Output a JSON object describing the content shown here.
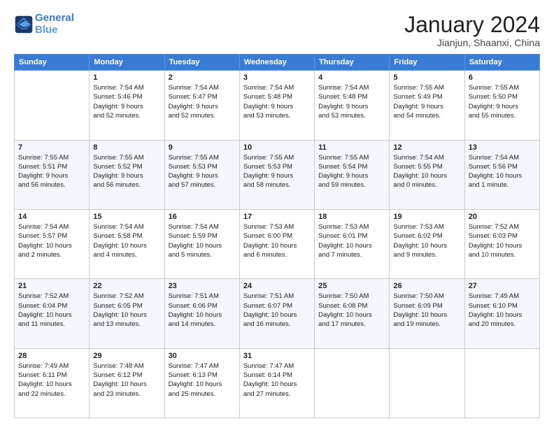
{
  "header": {
    "logo_line1": "General",
    "logo_line2": "Blue",
    "month_title": "January 2024",
    "subtitle": "Jianjun, Shaanxi, China"
  },
  "weekdays": [
    "Sunday",
    "Monday",
    "Tuesday",
    "Wednesday",
    "Thursday",
    "Friday",
    "Saturday"
  ],
  "weeks": [
    [
      {
        "day": "",
        "lines": []
      },
      {
        "day": "1",
        "lines": [
          "Sunrise: 7:54 AM",
          "Sunset: 5:46 PM",
          "Daylight: 9 hours",
          "and 52 minutes."
        ]
      },
      {
        "day": "2",
        "lines": [
          "Sunrise: 7:54 AM",
          "Sunset: 5:47 PM",
          "Daylight: 9 hours",
          "and 52 minutes."
        ]
      },
      {
        "day": "3",
        "lines": [
          "Sunrise: 7:54 AM",
          "Sunset: 5:48 PM",
          "Daylight: 9 hours",
          "and 53 minutes."
        ]
      },
      {
        "day": "4",
        "lines": [
          "Sunrise: 7:54 AM",
          "Sunset: 5:48 PM",
          "Daylight: 9 hours",
          "and 53 minutes."
        ]
      },
      {
        "day": "5",
        "lines": [
          "Sunrise: 7:55 AM",
          "Sunset: 5:49 PM",
          "Daylight: 9 hours",
          "and 54 minutes."
        ]
      },
      {
        "day": "6",
        "lines": [
          "Sunrise: 7:55 AM",
          "Sunset: 5:50 PM",
          "Daylight: 9 hours",
          "and 55 minutes."
        ]
      }
    ],
    [
      {
        "day": "7",
        "lines": [
          "Sunrise: 7:55 AM",
          "Sunset: 5:51 PM",
          "Daylight: 9 hours",
          "and 56 minutes."
        ]
      },
      {
        "day": "8",
        "lines": [
          "Sunrise: 7:55 AM",
          "Sunset: 5:52 PM",
          "Daylight: 9 hours",
          "and 56 minutes."
        ]
      },
      {
        "day": "9",
        "lines": [
          "Sunrise: 7:55 AM",
          "Sunset: 5:53 PM",
          "Daylight: 9 hours",
          "and 57 minutes."
        ]
      },
      {
        "day": "10",
        "lines": [
          "Sunrise: 7:55 AM",
          "Sunset: 5:53 PM",
          "Daylight: 9 hours",
          "and 58 minutes."
        ]
      },
      {
        "day": "11",
        "lines": [
          "Sunrise: 7:55 AM",
          "Sunset: 5:54 PM",
          "Daylight: 9 hours",
          "and 59 minutes."
        ]
      },
      {
        "day": "12",
        "lines": [
          "Sunrise: 7:54 AM",
          "Sunset: 5:55 PM",
          "Daylight: 10 hours",
          "and 0 minutes."
        ]
      },
      {
        "day": "13",
        "lines": [
          "Sunrise: 7:54 AM",
          "Sunset: 5:56 PM",
          "Daylight: 10 hours",
          "and 1 minute."
        ]
      }
    ],
    [
      {
        "day": "14",
        "lines": [
          "Sunrise: 7:54 AM",
          "Sunset: 5:57 PM",
          "Daylight: 10 hours",
          "and 2 minutes."
        ]
      },
      {
        "day": "15",
        "lines": [
          "Sunrise: 7:54 AM",
          "Sunset: 5:58 PM",
          "Daylight: 10 hours",
          "and 4 minutes."
        ]
      },
      {
        "day": "16",
        "lines": [
          "Sunrise: 7:54 AM",
          "Sunset: 5:59 PM",
          "Daylight: 10 hours",
          "and 5 minutes."
        ]
      },
      {
        "day": "17",
        "lines": [
          "Sunrise: 7:53 AM",
          "Sunset: 6:00 PM",
          "Daylight: 10 hours",
          "and 6 minutes."
        ]
      },
      {
        "day": "18",
        "lines": [
          "Sunrise: 7:53 AM",
          "Sunset: 6:01 PM",
          "Daylight: 10 hours",
          "and 7 minutes."
        ]
      },
      {
        "day": "19",
        "lines": [
          "Sunrise: 7:53 AM",
          "Sunset: 6:02 PM",
          "Daylight: 10 hours",
          "and 9 minutes."
        ]
      },
      {
        "day": "20",
        "lines": [
          "Sunrise: 7:52 AM",
          "Sunset: 6:03 PM",
          "Daylight: 10 hours",
          "and 10 minutes."
        ]
      }
    ],
    [
      {
        "day": "21",
        "lines": [
          "Sunrise: 7:52 AM",
          "Sunset: 6:04 PM",
          "Daylight: 10 hours",
          "and 11 minutes."
        ]
      },
      {
        "day": "22",
        "lines": [
          "Sunrise: 7:52 AM",
          "Sunset: 6:05 PM",
          "Daylight: 10 hours",
          "and 13 minutes."
        ]
      },
      {
        "day": "23",
        "lines": [
          "Sunrise: 7:51 AM",
          "Sunset: 6:06 PM",
          "Daylight: 10 hours",
          "and 14 minutes."
        ]
      },
      {
        "day": "24",
        "lines": [
          "Sunrise: 7:51 AM",
          "Sunset: 6:07 PM",
          "Daylight: 10 hours",
          "and 16 minutes."
        ]
      },
      {
        "day": "25",
        "lines": [
          "Sunrise: 7:50 AM",
          "Sunset: 6:08 PM",
          "Daylight: 10 hours",
          "and 17 minutes."
        ]
      },
      {
        "day": "26",
        "lines": [
          "Sunrise: 7:50 AM",
          "Sunset: 6:09 PM",
          "Daylight: 10 hours",
          "and 19 minutes."
        ]
      },
      {
        "day": "27",
        "lines": [
          "Sunrise: 7:49 AM",
          "Sunset: 6:10 PM",
          "Daylight: 10 hours",
          "and 20 minutes."
        ]
      }
    ],
    [
      {
        "day": "28",
        "lines": [
          "Sunrise: 7:49 AM",
          "Sunset: 6:11 PM",
          "Daylight: 10 hours",
          "and 22 minutes."
        ]
      },
      {
        "day": "29",
        "lines": [
          "Sunrise: 7:48 AM",
          "Sunset: 6:12 PM",
          "Daylight: 10 hours",
          "and 23 minutes."
        ]
      },
      {
        "day": "30",
        "lines": [
          "Sunrise: 7:47 AM",
          "Sunset: 6:13 PM",
          "Daylight: 10 hours",
          "and 25 minutes."
        ]
      },
      {
        "day": "31",
        "lines": [
          "Sunrise: 7:47 AM",
          "Sunset: 6:14 PM",
          "Daylight: 10 hours",
          "and 27 minutes."
        ]
      },
      {
        "day": "",
        "lines": []
      },
      {
        "day": "",
        "lines": []
      },
      {
        "day": "",
        "lines": []
      }
    ]
  ]
}
